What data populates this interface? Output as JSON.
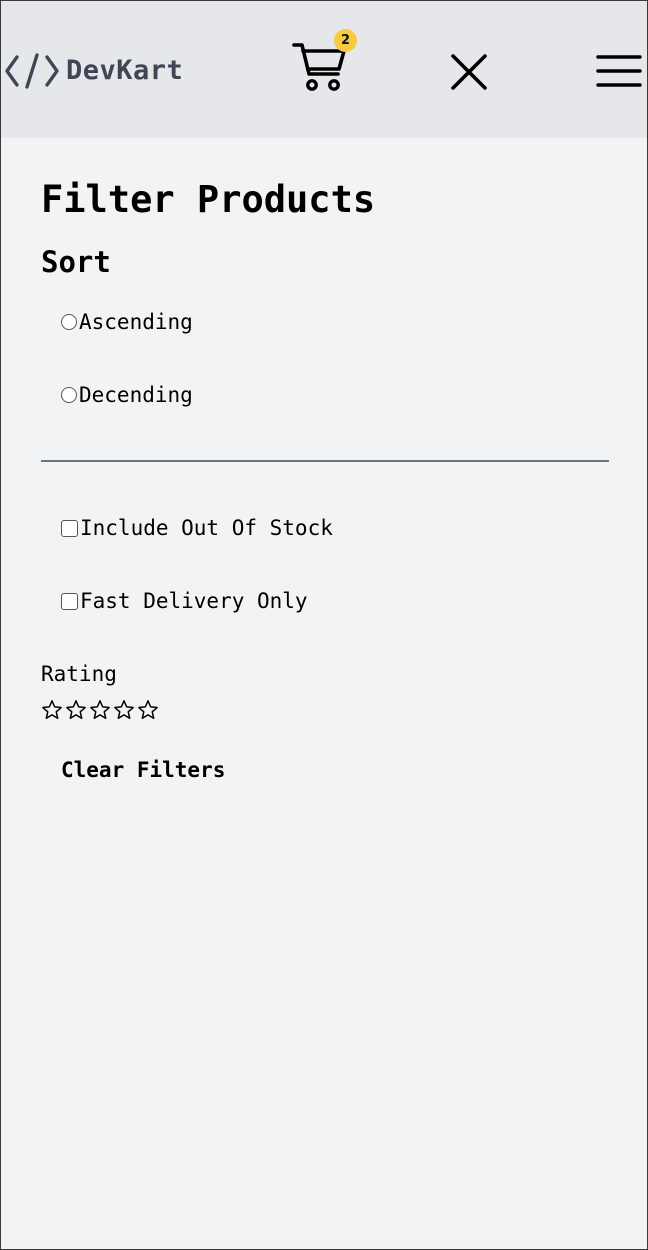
{
  "header": {
    "brand_name": "DevKart",
    "cart_count": "2",
    "icons": {
      "logo": "code-brackets-icon",
      "cart": "shopping-cart-icon",
      "close": "close-icon",
      "menu": "hamburger-menu-icon"
    },
    "badge_color": "#f5cc3f",
    "background_color": "#e5e7eb"
  },
  "filters": {
    "title": "Filter Products",
    "sort": {
      "heading": "Sort",
      "options": [
        {
          "label": "Ascending",
          "selected": false
        },
        {
          "label": "Decending",
          "selected": false
        }
      ]
    },
    "checkboxes": [
      {
        "label": "Include Out Of Stock",
        "checked": false
      },
      {
        "label": "Fast Delivery Only",
        "checked": false
      }
    ],
    "rating": {
      "label": "Rating",
      "max": 5,
      "value": 0,
      "icon": "star-outline-icon"
    },
    "clear_label": "Clear Filters"
  },
  "colors": {
    "page_background": "#f2f3f5",
    "brand_text": "#3f4756",
    "divider": "#6b7280"
  }
}
